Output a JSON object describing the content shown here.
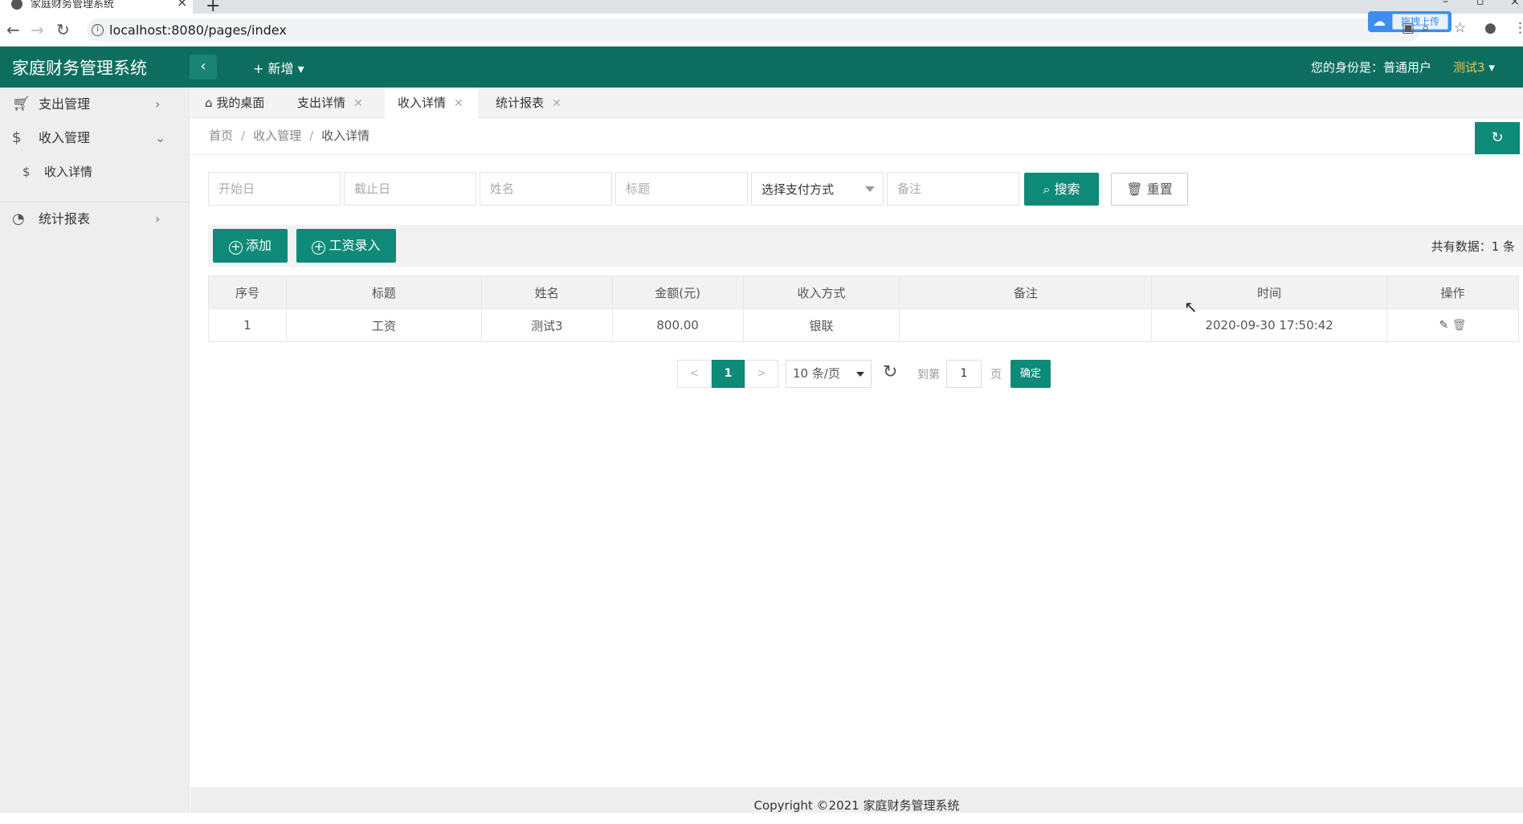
{
  "browser": {
    "tab_title": "家庭财务管理系统",
    "url": "localhost:8080/pages/index",
    "upload_chip": "拖拽上传"
  },
  "header": {
    "app_title": "家庭财务管理系统",
    "new_label": "新增",
    "identity_label": "您的身份是：普通用户",
    "user_name": "测试3"
  },
  "sidebar": {
    "items": [
      {
        "label": "支出管理",
        "icon": "cart-icon"
      },
      {
        "label": "收入管理",
        "icon": "dollar-icon"
      },
      {
        "label": "收入详情",
        "icon": "dollar-icon"
      },
      {
        "label": "统计报表",
        "icon": "chart-icon"
      }
    ]
  },
  "tabs": [
    {
      "label": "我的桌面"
    },
    {
      "label": "支出详情"
    },
    {
      "label": "收入详情"
    },
    {
      "label": "统计报表"
    }
  ],
  "breadcrumb": [
    "首页",
    "收入管理",
    "收入详情"
  ],
  "filters": {
    "start_date": "开始日",
    "end_date": "截止日",
    "name": "姓名",
    "title": "标题",
    "pay_method": "选择支付方式",
    "remark": "备注",
    "search_label": "搜索",
    "reset_label": "重置"
  },
  "toolbar": {
    "add_label": "添加",
    "salary_label": "工资录入",
    "total": "共有数据：1 条"
  },
  "table": {
    "columns": [
      "序号",
      "标题",
      "姓名",
      "金额(元)",
      "收入方式",
      "备注",
      "时间",
      "操作"
    ],
    "rows": [
      [
        "1",
        "工资",
        "测试3",
        "800.00",
        "银联",
        "",
        "2020-09-30 17:50:42"
      ]
    ]
  },
  "pagination": {
    "prev": "<",
    "current": "1",
    "next": ">",
    "page_size": "10 条/页",
    "goto_prefix": "到第",
    "goto_value": "1",
    "goto_suffix": "页",
    "confirm": "确定"
  },
  "footer": "Copyright ©2021 家庭财务管理系统",
  "colors": {
    "header_bg": "#0d6e5f",
    "primary": "#0e8a78",
    "user_accent": "#f3c44a"
  }
}
